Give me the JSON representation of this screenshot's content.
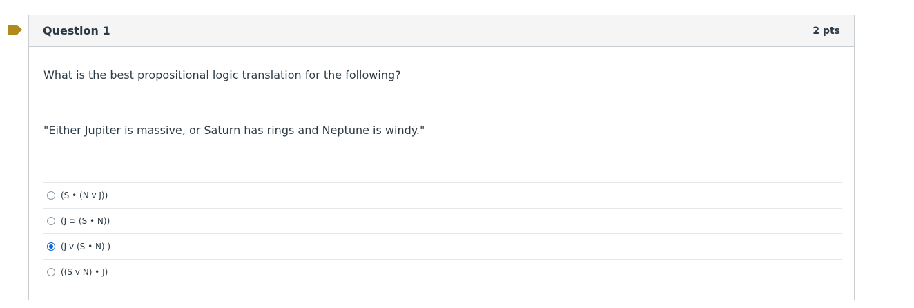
{
  "question": {
    "title": "Question 1",
    "points": "2 pts",
    "text_line1": "What is the best propositional logic translation for the following?",
    "text_line2": "\"Either Jupiter is massive, or Saturn has rings and Neptune is windy.\"",
    "flag_color": "#b08a1a",
    "answers": [
      {
        "label": "(S • (N v J))",
        "selected": false
      },
      {
        "label": "(J ⊃ (S • N))",
        "selected": false
      },
      {
        "label": "(J v (S • N) )",
        "selected": true
      },
      {
        "label": "((S v N) • J)",
        "selected": false
      }
    ]
  }
}
